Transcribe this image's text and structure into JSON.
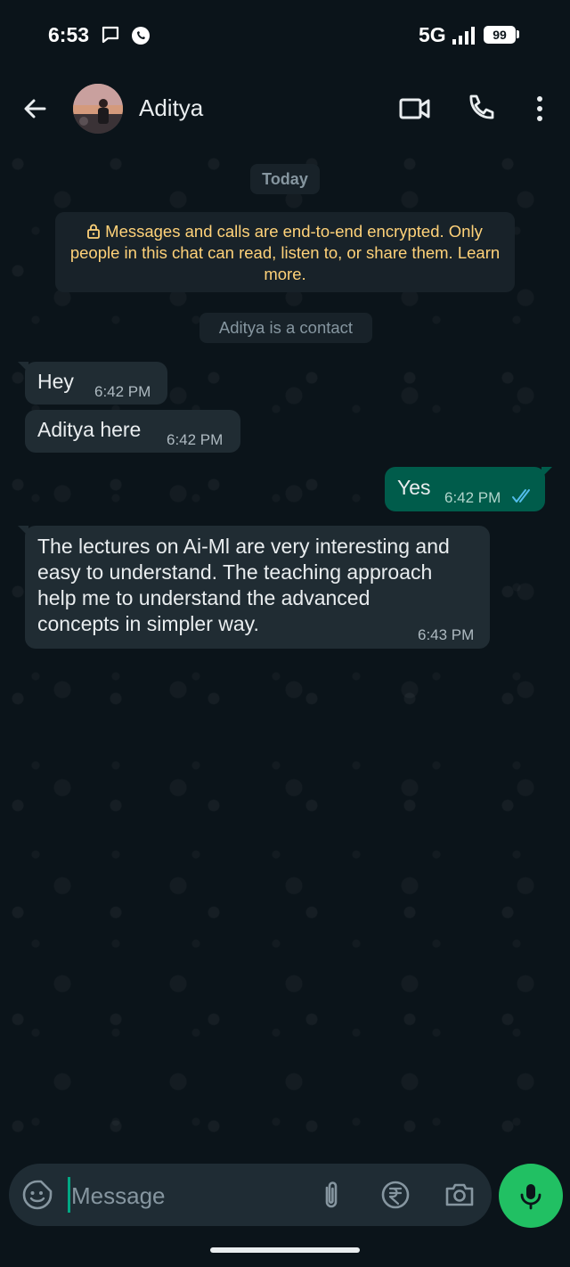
{
  "status_bar": {
    "time": "6:53",
    "network": "5G",
    "battery": "99"
  },
  "header": {
    "contact_name": "Aditya"
  },
  "chat": {
    "date_pill": "Today",
    "encryption_notice": "Messages and calls are end-to-end encrypted. Only people in this chat can read, listen to, or share them. Learn more.",
    "contact_pill": "Aditya is a contact",
    "messages": [
      {
        "direction": "incoming",
        "text": "Hey",
        "time": "6:42 PM"
      },
      {
        "direction": "incoming",
        "text": "Aditya here",
        "time": "6:42 PM"
      },
      {
        "direction": "outgoing",
        "text": "Yes",
        "time": "6:42 PM",
        "status": "read"
      },
      {
        "direction": "incoming",
        "lines": [
          "The lectures on Ai-Ml are very interesting and",
          "easy to understand.  The teaching approach",
          "help me to understand the advanced",
          "concepts in simpler way."
        ],
        "time": "6:43 PM"
      }
    ]
  },
  "composer": {
    "placeholder": "Message"
  },
  "colors": {
    "background": "#0b141a",
    "incoming_bubble": "#202c33",
    "outgoing_bubble": "#005c4b",
    "accent": "#21c063",
    "notice_text": "#ffd279",
    "read_ticks": "#53bdeb"
  }
}
